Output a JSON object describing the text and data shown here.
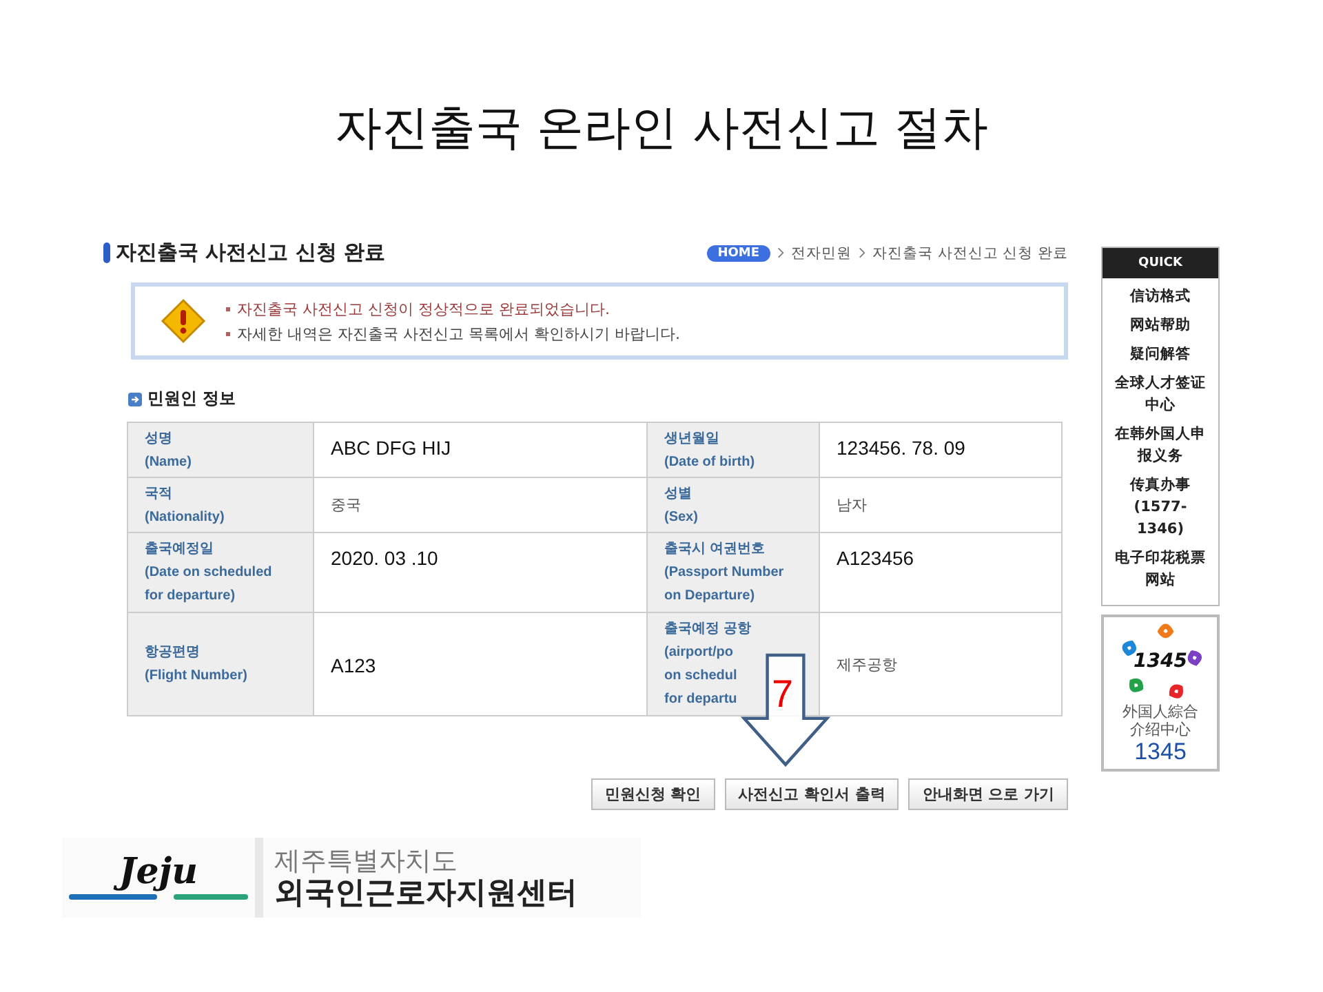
{
  "slide_title": "자진출국 온라인 사전신고 절차",
  "page": {
    "title": "자진출국 사전신고 신청 완료",
    "breadcrumb": [
      {
        "kind": "home",
        "label": "HOME"
      },
      {
        "kind": "link",
        "label": "전자민원"
      },
      {
        "kind": "link",
        "label": "자진출국 사전신고 신청 완료"
      }
    ],
    "notice": [
      {
        "kind": "highlight",
        "text": "자진출국 사전신고 신청이 정상적으로 완료되었습니다."
      },
      {
        "kind": "plain",
        "text": "자세한 내역은 자진출국 사전신고 목록에서 확인하시기 바랍니다."
      }
    ],
    "section_title": "민원인 정보",
    "rows": [
      {
        "cells": [
          {
            "kind": "label",
            "lines": [
              "성명",
              "(Name)"
            ]
          },
          {
            "kind": "entered",
            "text": "ABC  DFG  HIJ"
          },
          {
            "kind": "label",
            "lines": [
              "생년월일",
              "(Date of birth)"
            ]
          },
          {
            "kind": "entered",
            "text": "123456. 78. 09"
          }
        ]
      },
      {
        "cells": [
          {
            "kind": "label",
            "lines": [
              "국적",
              "(Nationality)"
            ]
          },
          {
            "kind": "value",
            "text": "중국"
          },
          {
            "kind": "label",
            "lines": [
              "성별",
              "(Sex)"
            ]
          },
          {
            "kind": "value",
            "text": "남자"
          }
        ]
      },
      {
        "cells": [
          {
            "kind": "label",
            "lines": [
              "출국예정일",
              "(Date on scheduled",
              "for departure)"
            ]
          },
          {
            "kind": "entered",
            "text": "2020. 03 .10"
          },
          {
            "kind": "label",
            "lines": [
              "출국시 여권번호",
              "(Passport Number",
              "on Departure)"
            ]
          },
          {
            "kind": "entered",
            "text": "A123456"
          }
        ]
      },
      {
        "cells": [
          {
            "kind": "label",
            "lines": [
              "항공편명",
              "(Flight Number)"
            ]
          },
          {
            "kind": "entered",
            "text": "A123"
          },
          {
            "kind": "label",
            "lines": [
              "출국예정 공항",
              "(airport/po",
              "on schedul",
              "for departu"
            ]
          },
          {
            "kind": "value",
            "text": "제주공항"
          }
        ]
      }
    ],
    "buttons": [
      "민원신청 확인",
      "사전신고 확인서 출력",
      "안내화면 으로 가기"
    ],
    "step_marker": "7"
  },
  "quick": {
    "title": "QUICK",
    "items": [
      "信访格式",
      "网站帮助",
      "疑问解答",
      "全球人才签证中心",
      "在韩外国人申报义务",
      "传真办事 (1577-1346)",
      "电子印花税票网站"
    ],
    "center": {
      "logo_number": "1345",
      "name": "外国人綜合介绍中心",
      "number": "1345"
    }
  },
  "footer_logo": {
    "mark": "Jeju",
    "subtitle": "제주특별자치도",
    "name": "외국인근로자지원센터"
  }
}
